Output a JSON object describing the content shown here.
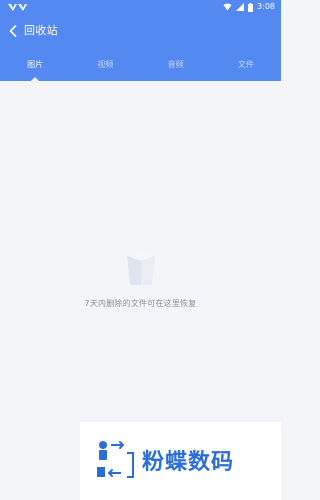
{
  "statusbar": {
    "time": "3:08"
  },
  "appbar": {
    "back_icon": "chevron-left-icon",
    "title": "回收站"
  },
  "tabs": [
    {
      "label": "图片",
      "active": true
    },
    {
      "label": "视频",
      "active": false
    },
    {
      "label": "音频",
      "active": false
    },
    {
      "label": "文件",
      "active": false
    }
  ],
  "empty_state": {
    "icon": "empty-box-icon",
    "message": "7天内删除的文件可在这里恢复"
  },
  "watermark": {
    "text": "粉蝶数码"
  },
  "colors": {
    "header": "#5589f2",
    "background": "#f4f5f9",
    "empty_text": "#8a8f99",
    "watermark_text": "#2b6fd6"
  }
}
